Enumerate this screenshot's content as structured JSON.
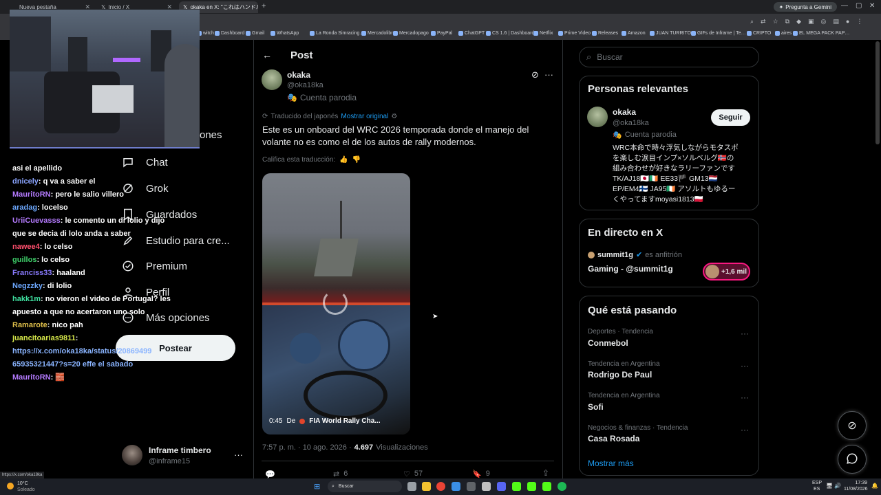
{
  "browser": {
    "tabs": [
      {
        "title": "Nueva pestaña"
      },
      {
        "title": "Inicio / X"
      },
      {
        "title": "okaka en X: \"これはハンドル握き…"
      }
    ],
    "gemini_label": "Pregunta a Gemini",
    "bookmarks": [
      "witch",
      "Dashboard",
      "Gmail",
      "WhatsApp",
      "La Ronda Simracing…",
      "Mercadolibre",
      "Mercadopago",
      "PayPal",
      "ChatGPT",
      "CS 1.6 | Dashboard",
      "Netflix",
      "Prime Video",
      "Releases",
      "Amazon",
      "JUAN TURRITO",
      "GIFs de Inframe | Te…",
      "CRIPTO",
      "aires",
      "EL MEGA PACK PAP…"
    ],
    "status_url": "https://x.com/oka18ka"
  },
  "nav": {
    "items": [
      {
        "label": "ones"
      },
      {
        "label": "Chat"
      },
      {
        "label": "Grok"
      },
      {
        "label": "Guardados"
      },
      {
        "label": "Estudio para cre..."
      },
      {
        "label": "Premium"
      },
      {
        "label": "Perfil"
      },
      {
        "label": "Más opciones"
      }
    ],
    "post_button": "Postear",
    "account": {
      "name": "Inframe timbero",
      "handle": "@inframe15"
    }
  },
  "chat": [
    {
      "user": "",
      "text": "asi el apellido",
      "color": "#ffffff"
    },
    {
      "user": "dnicely",
      "text": ": q va a saber el",
      "color": "#8aa4ff"
    },
    {
      "user": "MauritoRN",
      "text": ": pero le salio villero",
      "color": "#b57bff"
    },
    {
      "user": "aradag",
      "text": ": locelso",
      "color": "#6da8ff"
    },
    {
      "user": "UriiCuevasss",
      "text": ": le comento un di lolio y dijo que se decia di lolo anda a saber",
      "color": "#b57bff"
    },
    {
      "user": "nawee4",
      "text": ": lo celso",
      "color": "#ff4f6d"
    },
    {
      "user": "guillos",
      "text": ": lo celso",
      "color": "#3fd16b"
    },
    {
      "user": "Franciss33",
      "text": ": haaland",
      "color": "#8a7bff"
    },
    {
      "user": "Negzzky",
      "text": ": di lolio",
      "color": "#6da8ff"
    },
    {
      "user": "hakk1m",
      "text": ": no vieron el video de Portugal? les apuesto a que no acertaron uno solo",
      "color": "#3fe0a0"
    },
    {
      "user": "Ramarote",
      "text": ": nico pah",
      "color": "#e0c04b"
    },
    {
      "user": "juancitoarias9811",
      "text": ":",
      "color": "#d6e84a"
    },
    {
      "user": "",
      "text": "https://x.com/oka18ka/status/20869499 65935321447?s=20 effe el sabado",
      "color": "#ffffff"
    },
    {
      "user": "MauritoRN",
      "text": ": 🧱",
      "color": "#b57bff"
    }
  ],
  "post": {
    "header": "Post",
    "author": {
      "name": "okaka",
      "handle": "@oka18ka",
      "badge": "Cuenta parodia"
    },
    "translated_label": "Traducido del japonés",
    "show_original": "Mostrar original",
    "text": "Este es un onboard del WRC 2026 temporada donde el manejo del volante no es como el de los autos de rally modernos.",
    "rate_label": "Califica esta traducción:",
    "video": {
      "duration": "0:45",
      "from": "De",
      "source": "FIA World Rally Cha..."
    },
    "timestamp": "7:57 p. m. · 10 ago. 2026 ·",
    "views_count": "4.697",
    "views_label": "Visualizaciones",
    "actions": {
      "reposts": "6",
      "likes": "57",
      "bookmarks": "9"
    }
  },
  "sidebar": {
    "search_placeholder": "Buscar",
    "relevant": {
      "title": "Personas relevantes",
      "name": "okaka",
      "handle": "@oka18ka",
      "badge": "Cuenta parodia",
      "follow": "Seguir",
      "bio_lines": [
        "WRC本命で時々浮気しながらモタスポ",
        "を楽しむ涙目インプ×ソルベルグ🇳🇴の",
        "組み合わせが好きなラリーファンです",
        "TK/AJ18🇯🇵🇮🇪 EE33🏴 GM13🇳🇱",
        "EP/EM4🇫🇮 JA95🇮🇪 アソルトもゆるー",
        "くやってますmoyasi1813🇵🇱"
      ]
    },
    "live": {
      "title": "En directo en X",
      "host": "summit1g",
      "host_suffix": "es anfitrión",
      "space": "Gaming - @summit1g",
      "listeners": "+1,6 mil"
    },
    "trending": {
      "title": "Qué está pasando",
      "items": [
        {
          "context": "Deportes · Tendencia",
          "name": "Conmebol"
        },
        {
          "context": "Tendencia en Argentina",
          "name": "Rodrigo De Paul"
        },
        {
          "context": "Tendencia en Argentina",
          "name": "Sofi"
        },
        {
          "context": "Negocios & finanzas · Tendencia",
          "name": "Casa Rosada"
        }
      ],
      "show_more": "Mostrar más"
    }
  },
  "taskbar": {
    "weather_temp": "10°C",
    "weather_desc": "Soleado",
    "search": "Buscar",
    "lang": "ESP",
    "lang2": "ES",
    "time": "17:39",
    "date": "11/08/2026"
  }
}
